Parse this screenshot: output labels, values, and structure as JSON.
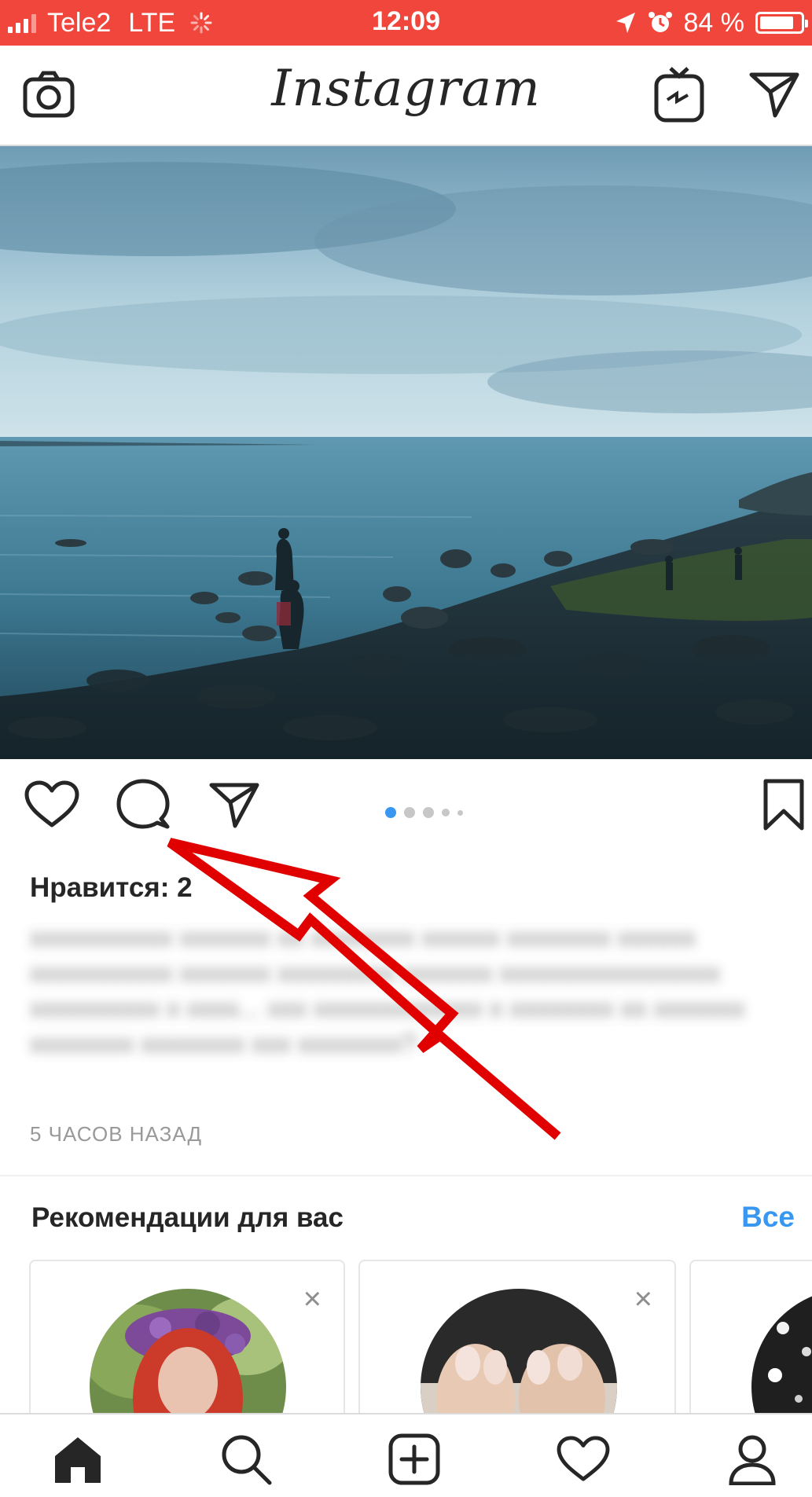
{
  "status_bar": {
    "carrier": "Tele2",
    "network": "LTE",
    "time": "12:09",
    "battery": "84 %",
    "battery_level": 0.84,
    "background_color": "#f0463c"
  },
  "header": {
    "logo_text": "Instagram",
    "left_icon": "camera-icon",
    "right_icons": [
      "igtv-icon",
      "direct-send-icon"
    ]
  },
  "post": {
    "actions": [
      "heart-icon",
      "comment-icon",
      "share-icon",
      "bookmark-icon"
    ],
    "carousel": {
      "count": 5,
      "active_index": 0,
      "active_color": "#3897f0"
    },
    "likes": "Нравится: 2",
    "caption": "xxxxxxxxxxx xxxxxxx xx xxxxxxxx xxxxxx xxxxxxxx xxxxxx xxxxxxxxxxx xxxxxxx xxxxxxxxx xxxxxxx xxxxxxxxxxxxxxxxx xxxxxxxxxx x xxxx... xxx xxxxxxxxxxxxx x xxxxxxxx xx xxxxxxx xxxxxxxx xxxxxxxx xxx xxxxxxxx?",
    "time_ago": "5 ЧАСОВ НАЗАД"
  },
  "recommendations": {
    "title": "Рекомендации для вас",
    "see_all": "Все",
    "close_glyph": "×",
    "accent_color": "#3897f0"
  },
  "bottom_nav": [
    "home-icon",
    "search-icon",
    "new-post-icon",
    "activity-heart-icon",
    "profile-icon"
  ],
  "annotation": {
    "arrow_color": "#e00000",
    "target": "comment-icon"
  }
}
